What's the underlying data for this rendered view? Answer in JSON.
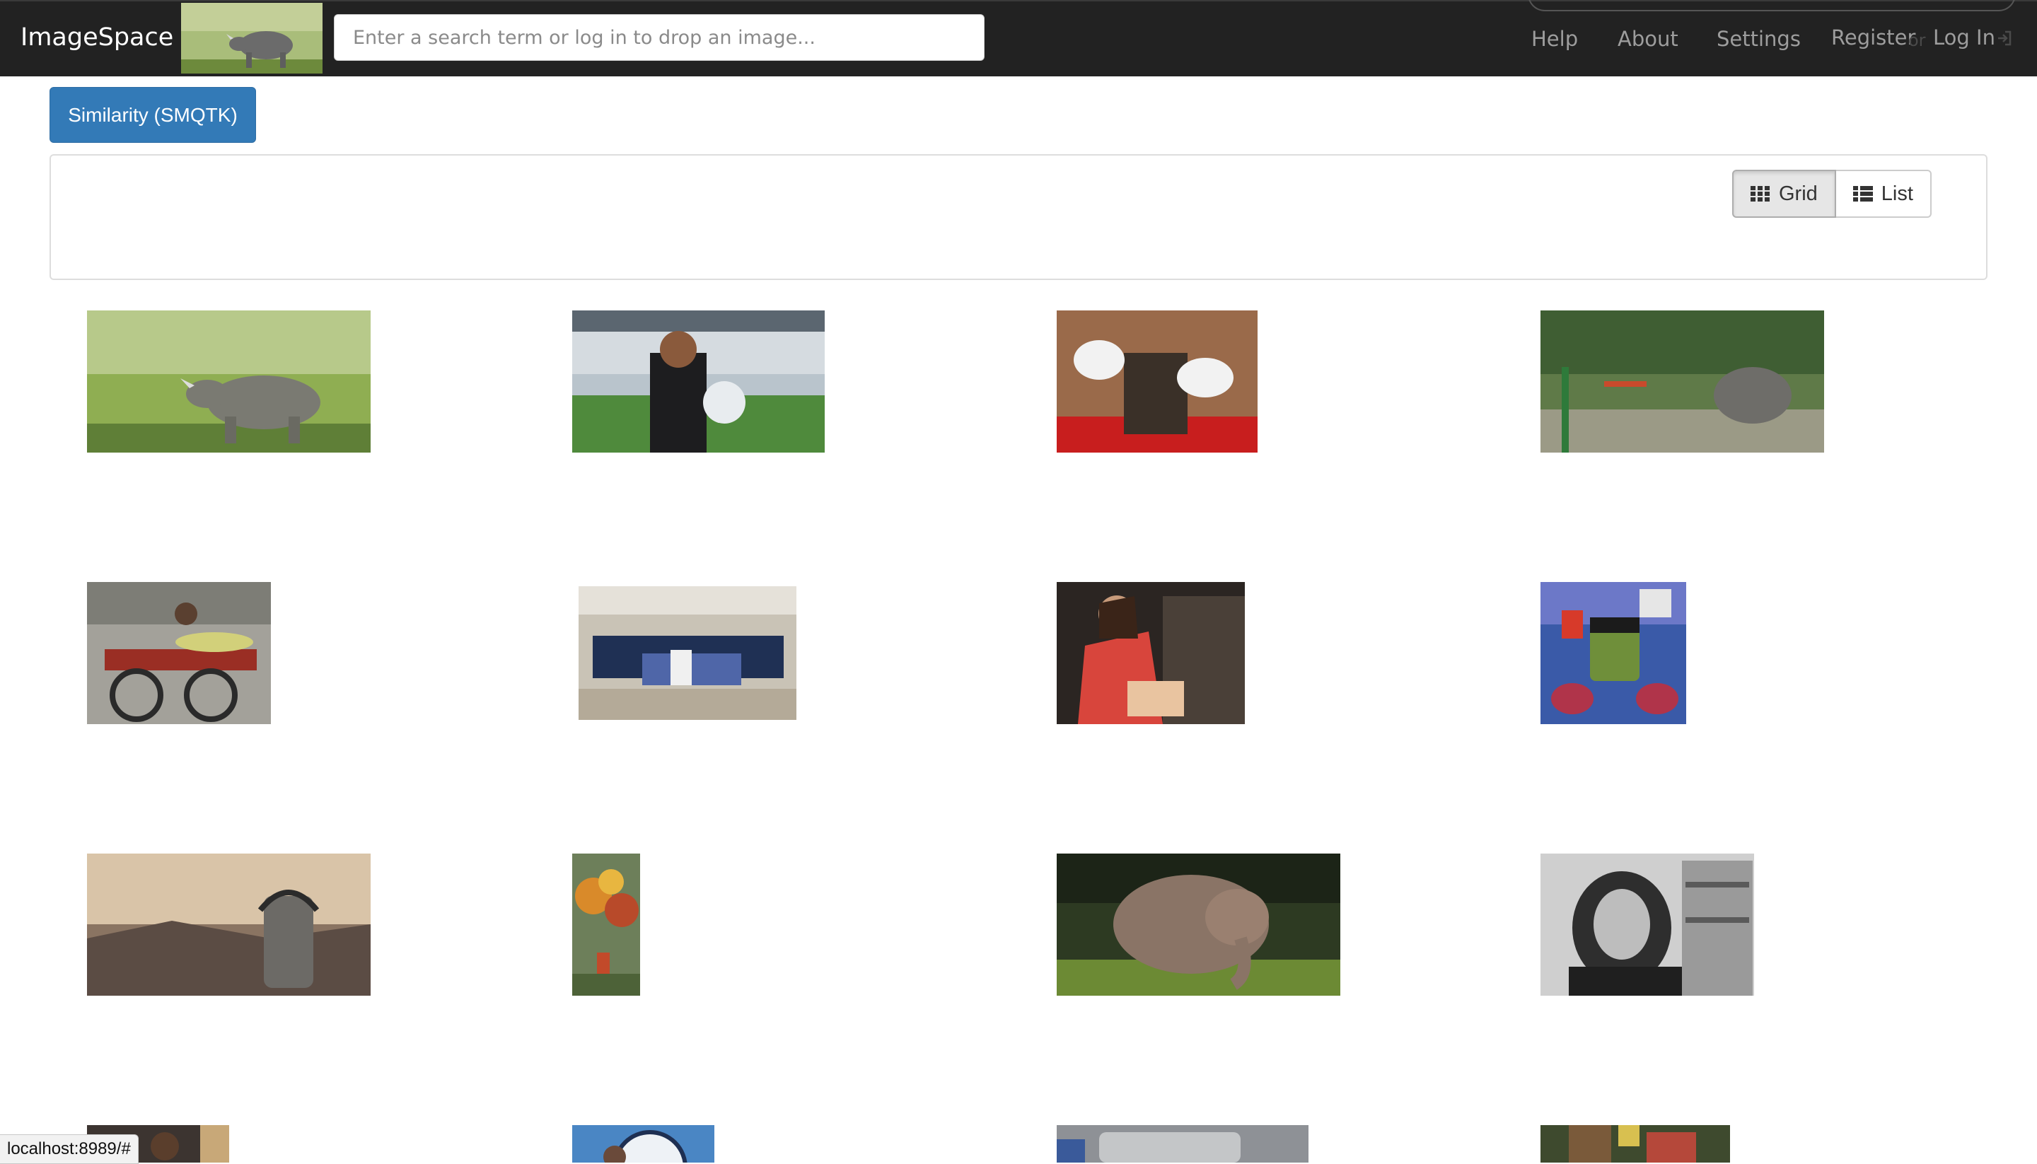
{
  "app": {
    "name": "ImageSpace"
  },
  "search": {
    "placeholder": "Enter a search term or log in to drop an image..."
  },
  "nav": {
    "help": "Help",
    "about": "About",
    "settings": "Settings",
    "register": "Register",
    "or": "or",
    "login": "Log In"
  },
  "tabs": {
    "similarity": "Similarity (SMQTK)"
  },
  "view_toggle": {
    "grid": "Grid",
    "list": "List",
    "selected": "Grid"
  },
  "results": [
    {
      "subject": "rhinoceros in grassland"
    },
    {
      "subject": "man holding soccer ball in stadium"
    },
    {
      "subject": "gloved hands holding dark object"
    },
    {
      "subject": "elephant in park"
    },
    {
      "subject": "street food cart"
    },
    {
      "subject": "team group photo"
    },
    {
      "subject": "woman in red sari"
    },
    {
      "subject": "green monster illustration"
    },
    {
      "subject": "moai statue with headphones"
    },
    {
      "subject": "illustrated autumn scene"
    },
    {
      "subject": "baby elephant"
    },
    {
      "subject": "black and white portrait woman"
    },
    {
      "subject": "man portrait"
    },
    {
      "subject": "club crest"
    },
    {
      "subject": "grey object"
    },
    {
      "subject": "colorful scene"
    }
  ],
  "status_bar": {
    "url": "localhost:8989/#"
  },
  "colors": {
    "navbar": "#222222",
    "primary": "#337ab7",
    "nav_text": "#9d9d9d"
  }
}
